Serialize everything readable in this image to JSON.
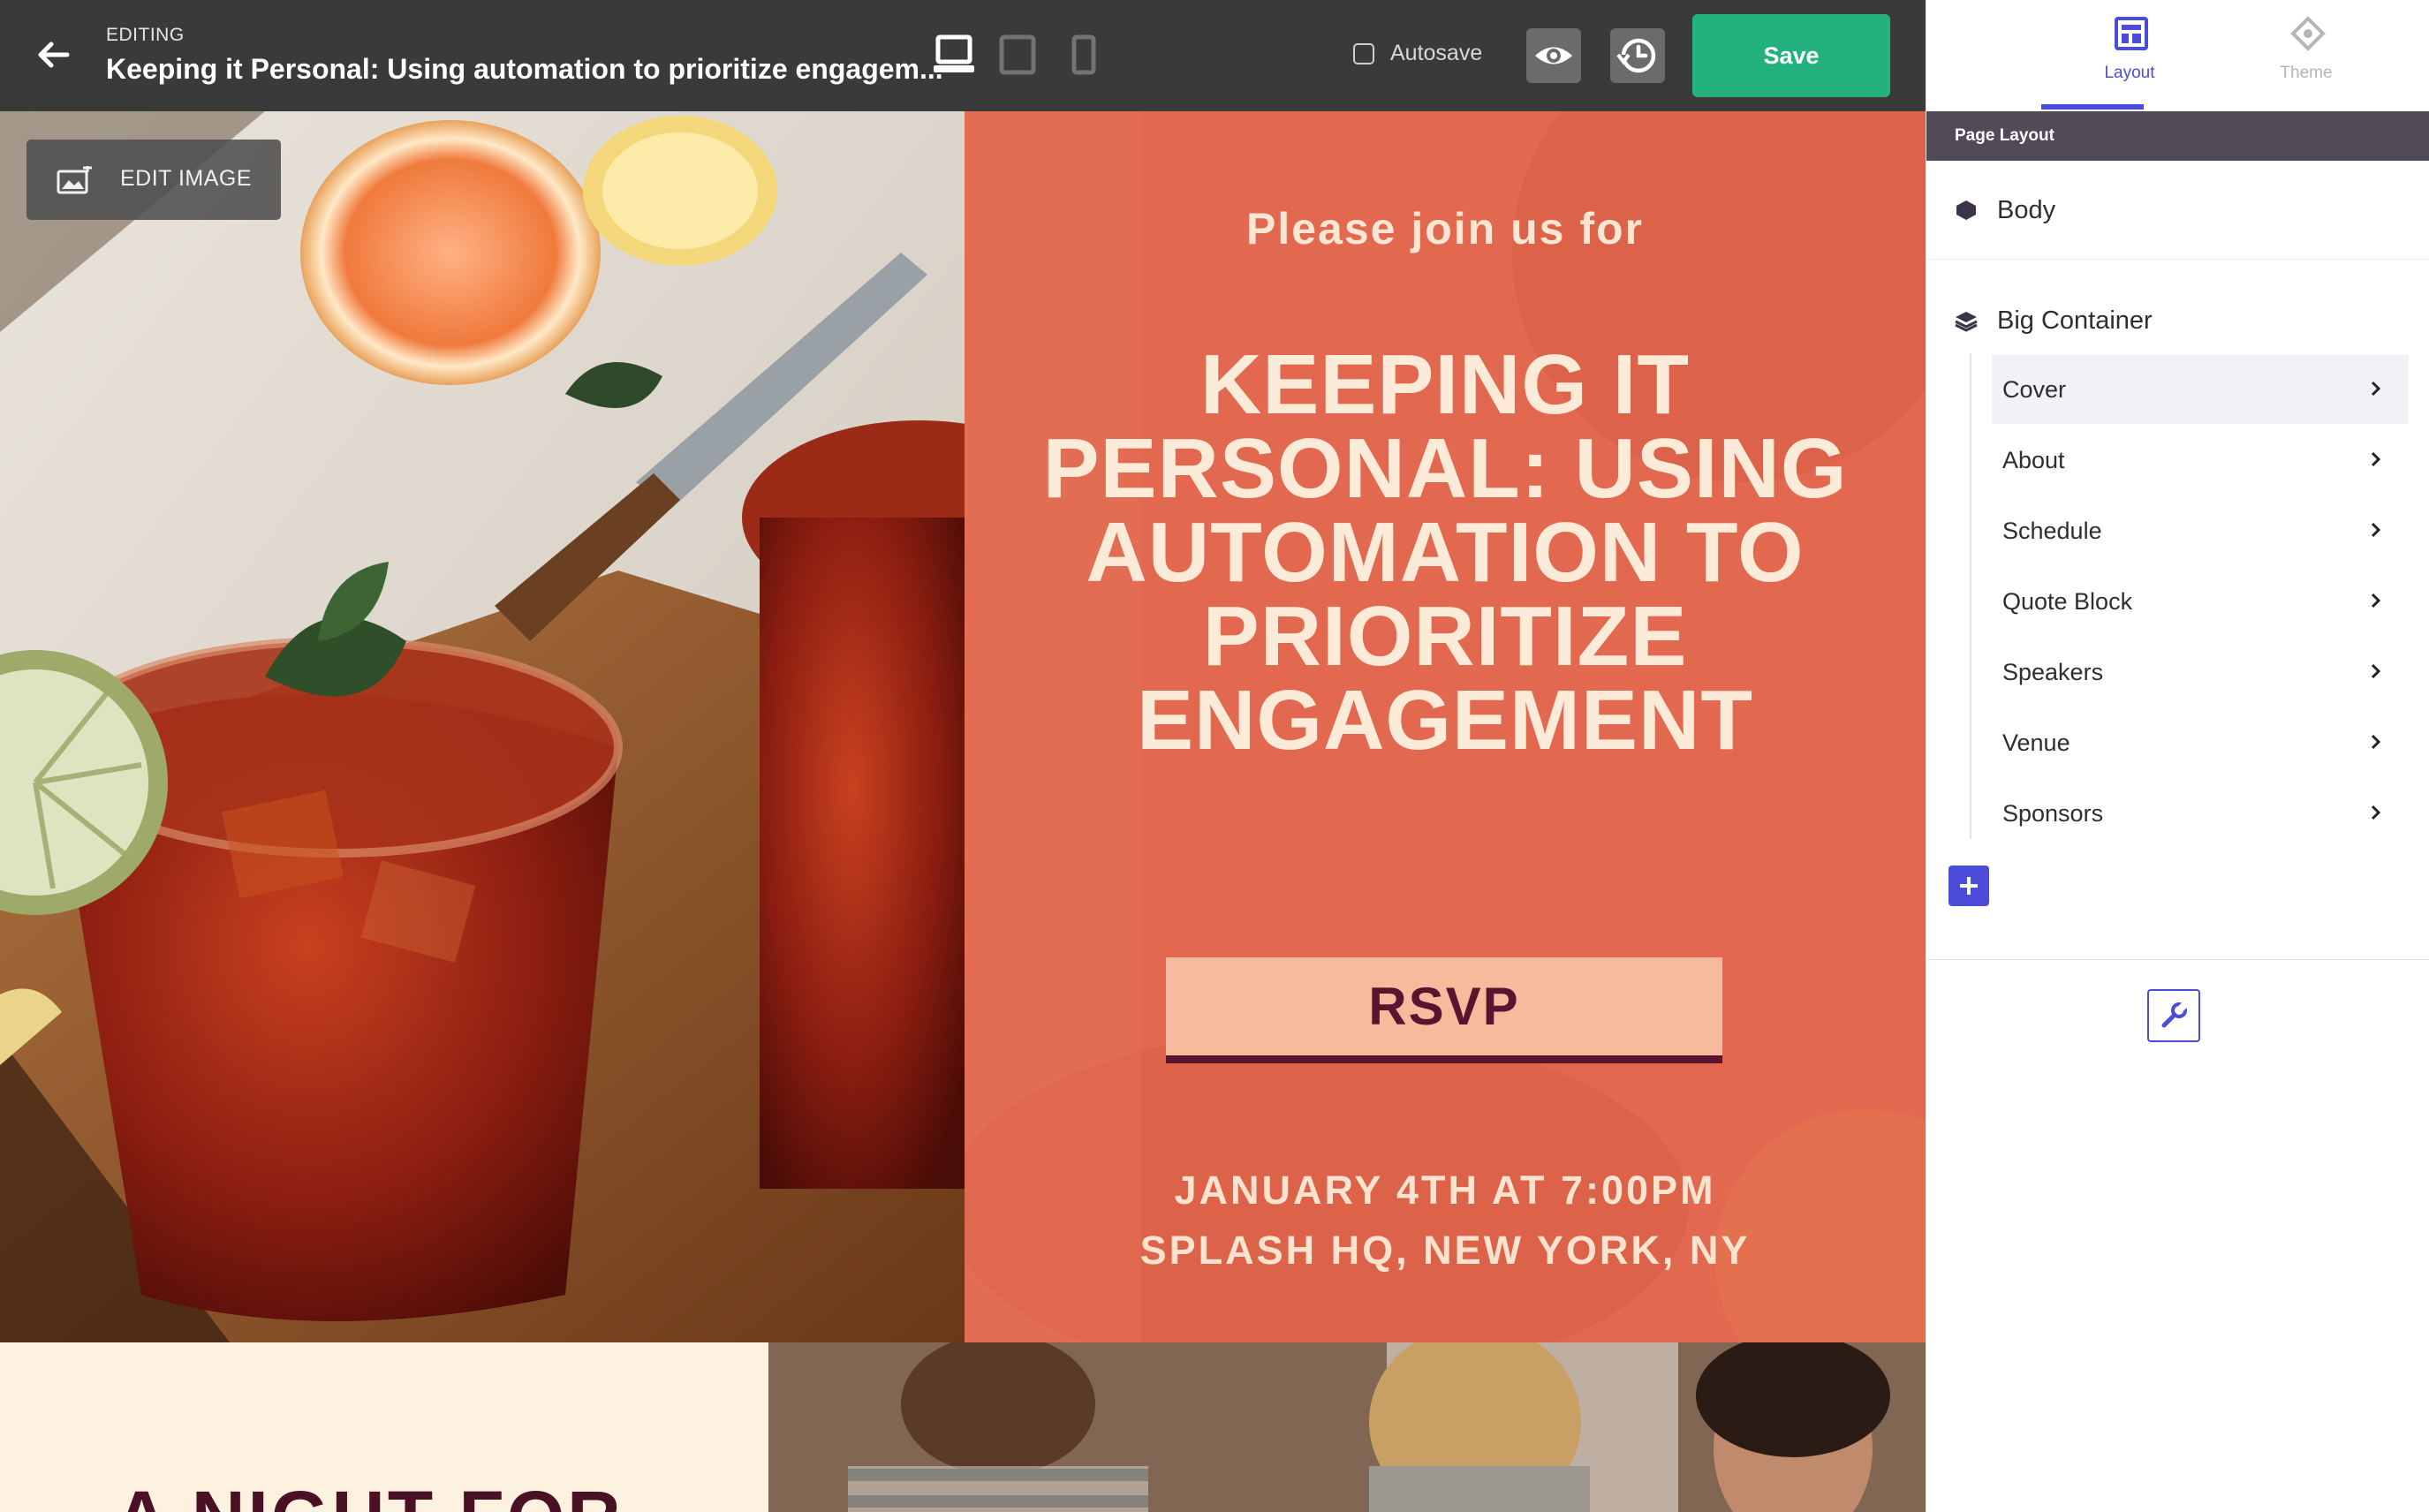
{
  "header": {
    "editing_label": "EDITING",
    "title": "Keeping it Personal: Using automation to prioritize engagem...",
    "device_icons": [
      "desktop-icon",
      "tablet-icon",
      "mobile-icon"
    ],
    "autosave_label": "Autosave",
    "autosave_checked": false,
    "save_label": "Save",
    "save_color": "#23b27e"
  },
  "canvas": {
    "edit_image_label": "EDIT IMAGE",
    "cover": {
      "kicker": "Please join us for",
      "title": "KEEPING IT PERSONAL: USING AUTOMATION TO PRIORITIZE ENGAGEMENT",
      "rsvp_label": "RSVP",
      "date": "JANUARY 4TH AT 7:00PM",
      "venue": "SPLASH HQ, NEW YORK, NY",
      "panel_color": "#e26950"
    },
    "about": {
      "heading": "A NIGHT FOR"
    }
  },
  "sidebar": {
    "tabs": [
      {
        "label": "Layout",
        "icon": "layout-icon",
        "active": true
      },
      {
        "label": "Theme",
        "icon": "theme-icon",
        "active": false
      }
    ],
    "section_header": "Page Layout",
    "body_label": "Body",
    "container_label": "Big Container",
    "children": [
      {
        "label": "Cover",
        "active": true
      },
      {
        "label": "About"
      },
      {
        "label": "Schedule"
      },
      {
        "label": "Quote Block"
      },
      {
        "label": "Speakers"
      },
      {
        "label": "Venue"
      },
      {
        "label": "Sponsors"
      }
    ],
    "accent_color": "#4b4cd9"
  }
}
